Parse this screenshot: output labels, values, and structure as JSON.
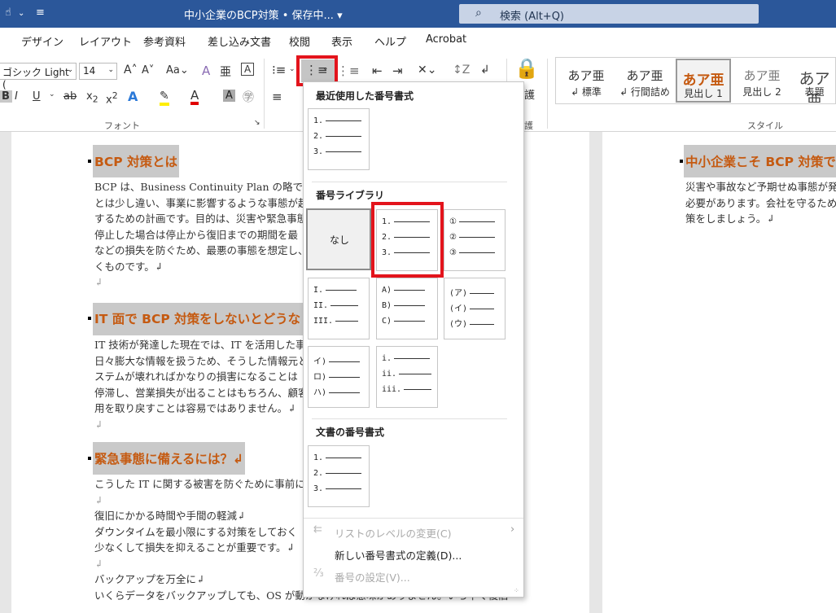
{
  "title_bar": {
    "title": "中小企業のBCP対策 • 保存中... ▾",
    "search_placeholder": "検索 (Alt+Q)"
  },
  "menu_tabs": [
    "デザイン",
    "レイアウト",
    "参考資料",
    "差し込み文書",
    "校閲",
    "表示",
    "ヘルプ",
    "Acrobat"
  ],
  "ribbon": {
    "font_name": "ゴシック Light (",
    "font_size": "14",
    "font_group": "フォント",
    "styles_group": "スタイル",
    "protect_group": "護",
    "protect_label": "護",
    "styles": [
      {
        "preview": "あア亜",
        "name": "↲ 標準"
      },
      {
        "preview": "あア亜",
        "name": "↲ 行間詰め"
      },
      {
        "preview": "あア亜",
        "name": "見出し 1"
      },
      {
        "preview": "あア亜",
        "name": "見出し 2"
      },
      {
        "preview": "あア亜",
        "name": "表題"
      }
    ]
  },
  "numbering_menu": {
    "recent_title": "最近使用した番号書式",
    "library_title": "番号ライブラリ",
    "document_title": "文書の番号書式",
    "none_label": "なし",
    "recent_format": [
      "1.",
      "2.",
      "3."
    ],
    "library_formats": [
      [
        "1.",
        "2.",
        "3."
      ],
      [
        "①",
        "②",
        "③"
      ],
      [
        "I.",
        "II.",
        "III."
      ],
      [
        "A)",
        "B)",
        "C)"
      ],
      [
        "(ア)",
        "(イ)",
        "(ウ)"
      ],
      [
        "イ)",
        "ロ)",
        "ハ)"
      ],
      [
        "i.",
        "ii.",
        "iii."
      ]
    ],
    "document_format": [
      "1.",
      "2.",
      "3."
    ],
    "change_level": "リストのレベルの変更(C)",
    "define_new": "新しい番号書式の定義(D)...",
    "set_value": "番号の設定(V)..."
  },
  "document": {
    "headings": [
      "BCP 対策とは",
      "IT 面で BCP 対策をしないとどうな",
      "緊急事態に備えるには？↲"
    ],
    "para1": [
      "BCP は、Business Continuity Plan の略で、「",
      "とは少し違い、事業に影響するような事態が起",
      "するための計画です。目的は、災害や緊急事態",
      "停止した場合は停止から復旧までの期間を最",
      "などの損失を防ぐため、最悪の事態を想定し、",
      "くものです。↲"
    ],
    "para2": [
      "IT 技術が発達した現在では、IT を活用した事業",
      "日々膨大な情報を扱うため、そうした情報元と",
      "ステムが壊れればかなりの損害になることは",
      "停滞し、営業損失が出ることはもちろん、顧客",
      "用を取り戻すことは容易ではありません。↲"
    ],
    "para3": [
      "こうした IT に関する被害を防ぐために事前に",
      "↲",
      "復旧にかかる時間や手間の軽減↲",
      "ダウンタイムを最小限にする対策をしておく",
      "少なくして損失を抑えることが重要です。↲",
      "↲",
      "バックアップを万全に↲",
      "いくらデータをバックアップしても、OS が動かなければ意味がありません。いち早く復旧"
    ],
    "right_heading": "中小企業こそ BCP 対策で",
    "right_para": [
      "災害や事故など予期せぬ事態が発",
      "必要があります。会社を守るため",
      "策をしましょう。↲"
    ],
    "return_mark": "↲"
  }
}
